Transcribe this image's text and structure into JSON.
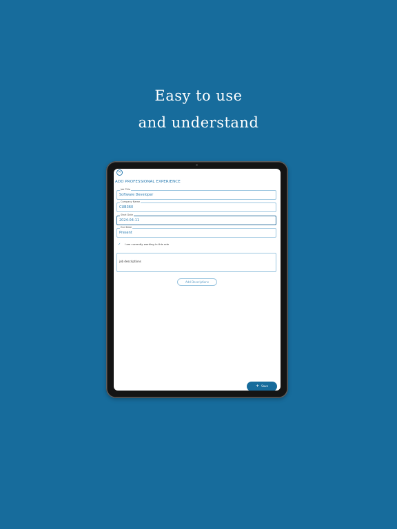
{
  "promo": {
    "line1": "Easy to use",
    "line2": "and understand"
  },
  "form": {
    "close_icon": "close-icon",
    "title": "ADD PROFESSIONAL EXPERIENCE",
    "fields": [
      {
        "label": "Job Title",
        "value": "Software Developer"
      },
      {
        "label": "Company Name",
        "value": "CUB360"
      },
      {
        "label": "Start Date",
        "value": "2024-04-11"
      },
      {
        "label": "End Date",
        "value": "Present"
      }
    ],
    "currently_working": {
      "label": "I am currently working in this role",
      "checked": true,
      "icon": "check-icon"
    },
    "description_text": "job descriptions",
    "add_descriptions_label": "Add Descriptions",
    "save_label": "Save",
    "save_icon": "plus-icon"
  },
  "colors": {
    "background": "#176c9c",
    "accent": "#2a7bb0",
    "field_border": "#9cc6e0"
  }
}
